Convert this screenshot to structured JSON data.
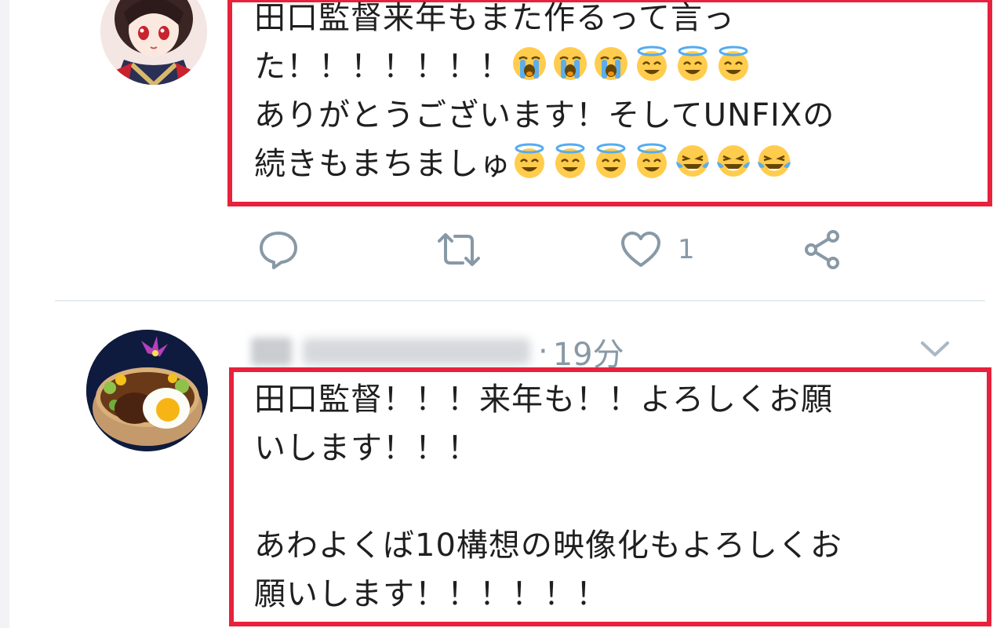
{
  "tweet1": {
    "lines": [
      "田口監督来年もまた作るって言っ",
      "た！！！！！！！",
      "ありがとうございます！そしてUNFIXの",
      "続きもまちましゅ"
    ],
    "line2_emojis": [
      "loudly-crying-face",
      "loudly-crying-face",
      "loudly-crying-face",
      "smiling-face-with-halo",
      "smiling-face-with-halo",
      "smiling-face-with-halo"
    ],
    "line4_emojis": [
      "smiling-face-with-halo",
      "smiling-face-with-halo",
      "smiling-face-with-halo",
      "smiling-face-with-halo",
      "face-with-tears-of-joy",
      "face-with-tears-of-joy",
      "face-with-tears-of-joy"
    ],
    "actions": {
      "reply_icon": "reply-icon",
      "retweet_icon": "retweet-icon",
      "like_icon": "heart-icon",
      "like_count": "1",
      "share_icon": "share-icon"
    }
  },
  "tweet2": {
    "time_separator": "·",
    "time": "19分",
    "menu_icon": "chevron-down-icon",
    "lines": [
      "田口監督！！！来年も！！よろしくお願",
      "いします！！！",
      "",
      "あわよくば10構想の映像化もよろしくお",
      "願いします！！！！！！"
    ]
  },
  "colors": {
    "highlight_border": "#e8213c",
    "icon_gray": "#8899a6",
    "divider": "#e6ecf0",
    "text": "#1f1f1f"
  }
}
